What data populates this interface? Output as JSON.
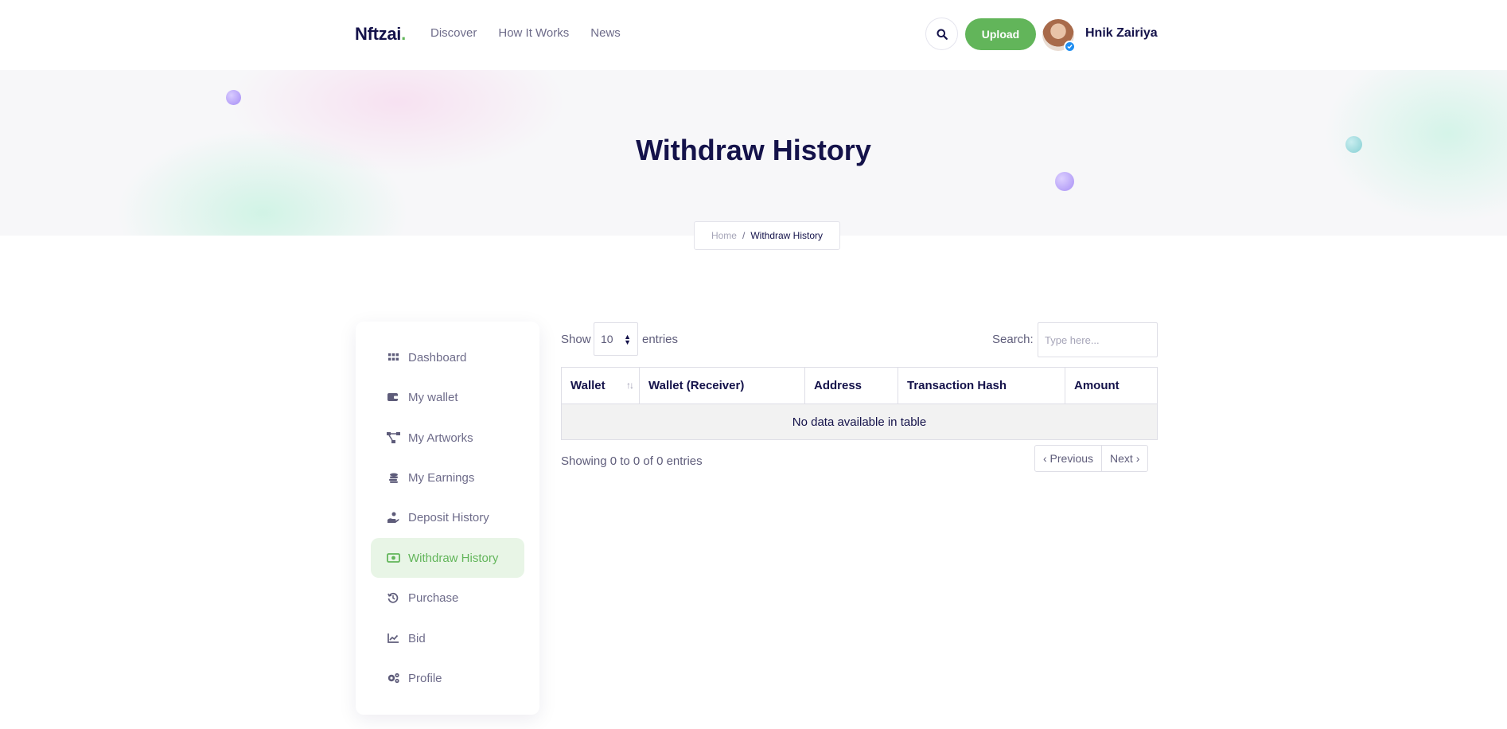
{
  "header": {
    "logo_text": "Nftzai",
    "logo_dot": ".",
    "nav": [
      "Discover",
      "How It Works",
      "News"
    ],
    "upload_label": "Upload",
    "username": "Hnik Zairiya"
  },
  "hero": {
    "title": "Withdraw History",
    "breadcrumb": {
      "home": "Home",
      "separator": "/",
      "current": "Withdraw History"
    }
  },
  "sidebar": {
    "items": [
      {
        "label": "Dashboard",
        "icon": "grid-icon"
      },
      {
        "label": "My wallet",
        "icon": "wallet-icon"
      },
      {
        "label": "My Artworks",
        "icon": "network-icon"
      },
      {
        "label": "My Earnings",
        "icon": "coins-icon"
      },
      {
        "label": "Deposit History",
        "icon": "hand-coin-icon"
      },
      {
        "label": "Withdraw History",
        "icon": "money-bill-icon",
        "active": true
      },
      {
        "label": "Purchase",
        "icon": "history-icon"
      },
      {
        "label": "Bid",
        "icon": "chart-line-icon"
      },
      {
        "label": "Profile",
        "icon": "gears-icon"
      }
    ]
  },
  "table_controls": {
    "show_label": "Show",
    "entries_value": "10",
    "entries_label": "entries",
    "search_label": "Search:",
    "search_placeholder": "Type here..."
  },
  "table": {
    "columns": [
      "Wallet",
      "Wallet (Receiver)",
      "Address",
      "Transaction Hash",
      "Amount"
    ],
    "empty_message": "No data available in table"
  },
  "pagination": {
    "info": "Showing 0 to 0 of 0 entries",
    "previous": "‹ Previous",
    "next": "Next ›"
  },
  "colors": {
    "brand_green": "#62b55a",
    "navy": "#14124a",
    "muted": "#6e6c8a",
    "badge_blue": "#1f8ef1"
  }
}
